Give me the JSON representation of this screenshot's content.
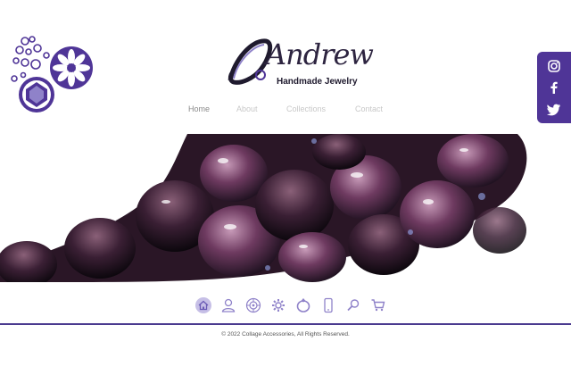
{
  "brand": {
    "logo_script": "Andrew",
    "tagline": "Handmade Jewelry"
  },
  "nav": {
    "items": [
      {
        "label": "Home",
        "active": true
      },
      {
        "label": "About",
        "active": false
      },
      {
        "label": "Collections",
        "active": false
      },
      {
        "label": "Contact",
        "active": false
      }
    ]
  },
  "social": {
    "color": "#4f3597",
    "icons": [
      "instagram-icon",
      "facebook-icon",
      "twitter-icon"
    ]
  },
  "iconbar": {
    "color": "#8f82c9",
    "icons": [
      "home-icon",
      "user-icon",
      "mandala-icon",
      "settings-icon",
      "ring-icon",
      "phone-icon",
      "search-icon",
      "cart-icon"
    ]
  },
  "footer": {
    "copyright": "© 2022  Collage Accessories, All Rights Reserved."
  },
  "colors": {
    "accent": "#4f3597",
    "rule": "#4a3a8f",
    "hero_dark": "#1a0f1c",
    "hero_bead": "#7a4a6e"
  }
}
